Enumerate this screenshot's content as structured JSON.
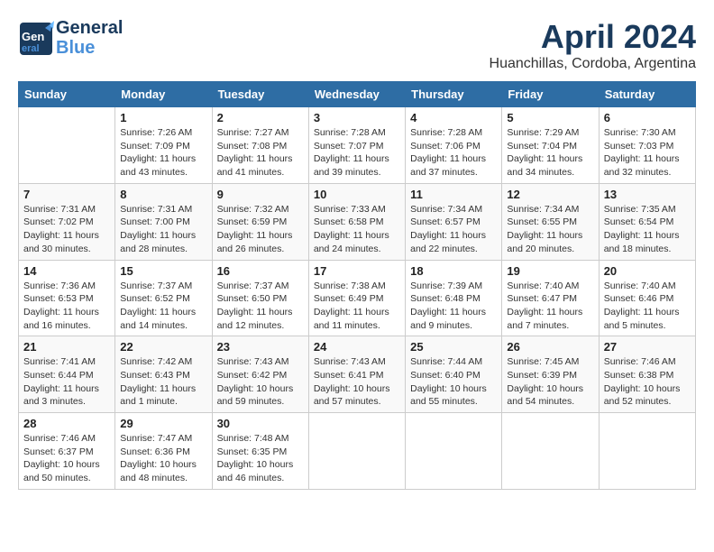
{
  "header": {
    "logo_line1": "General",
    "logo_line2": "Blue",
    "month_title": "April 2024",
    "location": "Huanchillas, Cordoba, Argentina"
  },
  "weekdays": [
    "Sunday",
    "Monday",
    "Tuesday",
    "Wednesday",
    "Thursday",
    "Friday",
    "Saturday"
  ],
  "weeks": [
    [
      {
        "day": "",
        "sunrise": "",
        "sunset": "",
        "daylight": ""
      },
      {
        "day": "1",
        "sunrise": "7:26 AM",
        "sunset": "7:09 PM",
        "daylight": "11 hours and 43 minutes."
      },
      {
        "day": "2",
        "sunrise": "7:27 AM",
        "sunset": "7:08 PM",
        "daylight": "11 hours and 41 minutes."
      },
      {
        "day": "3",
        "sunrise": "7:28 AM",
        "sunset": "7:07 PM",
        "daylight": "11 hours and 39 minutes."
      },
      {
        "day": "4",
        "sunrise": "7:28 AM",
        "sunset": "7:06 PM",
        "daylight": "11 hours and 37 minutes."
      },
      {
        "day": "5",
        "sunrise": "7:29 AM",
        "sunset": "7:04 PM",
        "daylight": "11 hours and 34 minutes."
      },
      {
        "day": "6",
        "sunrise": "7:30 AM",
        "sunset": "7:03 PM",
        "daylight": "11 hours and 32 minutes."
      }
    ],
    [
      {
        "day": "7",
        "sunrise": "7:31 AM",
        "sunset": "7:02 PM",
        "daylight": "11 hours and 30 minutes."
      },
      {
        "day": "8",
        "sunrise": "7:31 AM",
        "sunset": "7:00 PM",
        "daylight": "11 hours and 28 minutes."
      },
      {
        "day": "9",
        "sunrise": "7:32 AM",
        "sunset": "6:59 PM",
        "daylight": "11 hours and 26 minutes."
      },
      {
        "day": "10",
        "sunrise": "7:33 AM",
        "sunset": "6:58 PM",
        "daylight": "11 hours and 24 minutes."
      },
      {
        "day": "11",
        "sunrise": "7:34 AM",
        "sunset": "6:57 PM",
        "daylight": "11 hours and 22 minutes."
      },
      {
        "day": "12",
        "sunrise": "7:34 AM",
        "sunset": "6:55 PM",
        "daylight": "11 hours and 20 minutes."
      },
      {
        "day": "13",
        "sunrise": "7:35 AM",
        "sunset": "6:54 PM",
        "daylight": "11 hours and 18 minutes."
      }
    ],
    [
      {
        "day": "14",
        "sunrise": "7:36 AM",
        "sunset": "6:53 PM",
        "daylight": "11 hours and 16 minutes."
      },
      {
        "day": "15",
        "sunrise": "7:37 AM",
        "sunset": "6:52 PM",
        "daylight": "11 hours and 14 minutes."
      },
      {
        "day": "16",
        "sunrise": "7:37 AM",
        "sunset": "6:50 PM",
        "daylight": "11 hours and 12 minutes."
      },
      {
        "day": "17",
        "sunrise": "7:38 AM",
        "sunset": "6:49 PM",
        "daylight": "11 hours and 11 minutes."
      },
      {
        "day": "18",
        "sunrise": "7:39 AM",
        "sunset": "6:48 PM",
        "daylight": "11 hours and 9 minutes."
      },
      {
        "day": "19",
        "sunrise": "7:40 AM",
        "sunset": "6:47 PM",
        "daylight": "11 hours and 7 minutes."
      },
      {
        "day": "20",
        "sunrise": "7:40 AM",
        "sunset": "6:46 PM",
        "daylight": "11 hours and 5 minutes."
      }
    ],
    [
      {
        "day": "21",
        "sunrise": "7:41 AM",
        "sunset": "6:44 PM",
        "daylight": "11 hours and 3 minutes."
      },
      {
        "day": "22",
        "sunrise": "7:42 AM",
        "sunset": "6:43 PM",
        "daylight": "11 hours and 1 minute."
      },
      {
        "day": "23",
        "sunrise": "7:43 AM",
        "sunset": "6:42 PM",
        "daylight": "10 hours and 59 minutes."
      },
      {
        "day": "24",
        "sunrise": "7:43 AM",
        "sunset": "6:41 PM",
        "daylight": "10 hours and 57 minutes."
      },
      {
        "day": "25",
        "sunrise": "7:44 AM",
        "sunset": "6:40 PM",
        "daylight": "10 hours and 55 minutes."
      },
      {
        "day": "26",
        "sunrise": "7:45 AM",
        "sunset": "6:39 PM",
        "daylight": "10 hours and 54 minutes."
      },
      {
        "day": "27",
        "sunrise": "7:46 AM",
        "sunset": "6:38 PM",
        "daylight": "10 hours and 52 minutes."
      }
    ],
    [
      {
        "day": "28",
        "sunrise": "7:46 AM",
        "sunset": "6:37 PM",
        "daylight": "10 hours and 50 minutes."
      },
      {
        "day": "29",
        "sunrise": "7:47 AM",
        "sunset": "6:36 PM",
        "daylight": "10 hours and 48 minutes."
      },
      {
        "day": "30",
        "sunrise": "7:48 AM",
        "sunset": "6:35 PM",
        "daylight": "10 hours and 46 minutes."
      },
      {
        "day": "",
        "sunrise": "",
        "sunset": "",
        "daylight": ""
      },
      {
        "day": "",
        "sunrise": "",
        "sunset": "",
        "daylight": ""
      },
      {
        "day": "",
        "sunrise": "",
        "sunset": "",
        "daylight": ""
      },
      {
        "day": "",
        "sunrise": "",
        "sunset": "",
        "daylight": ""
      }
    ]
  ]
}
